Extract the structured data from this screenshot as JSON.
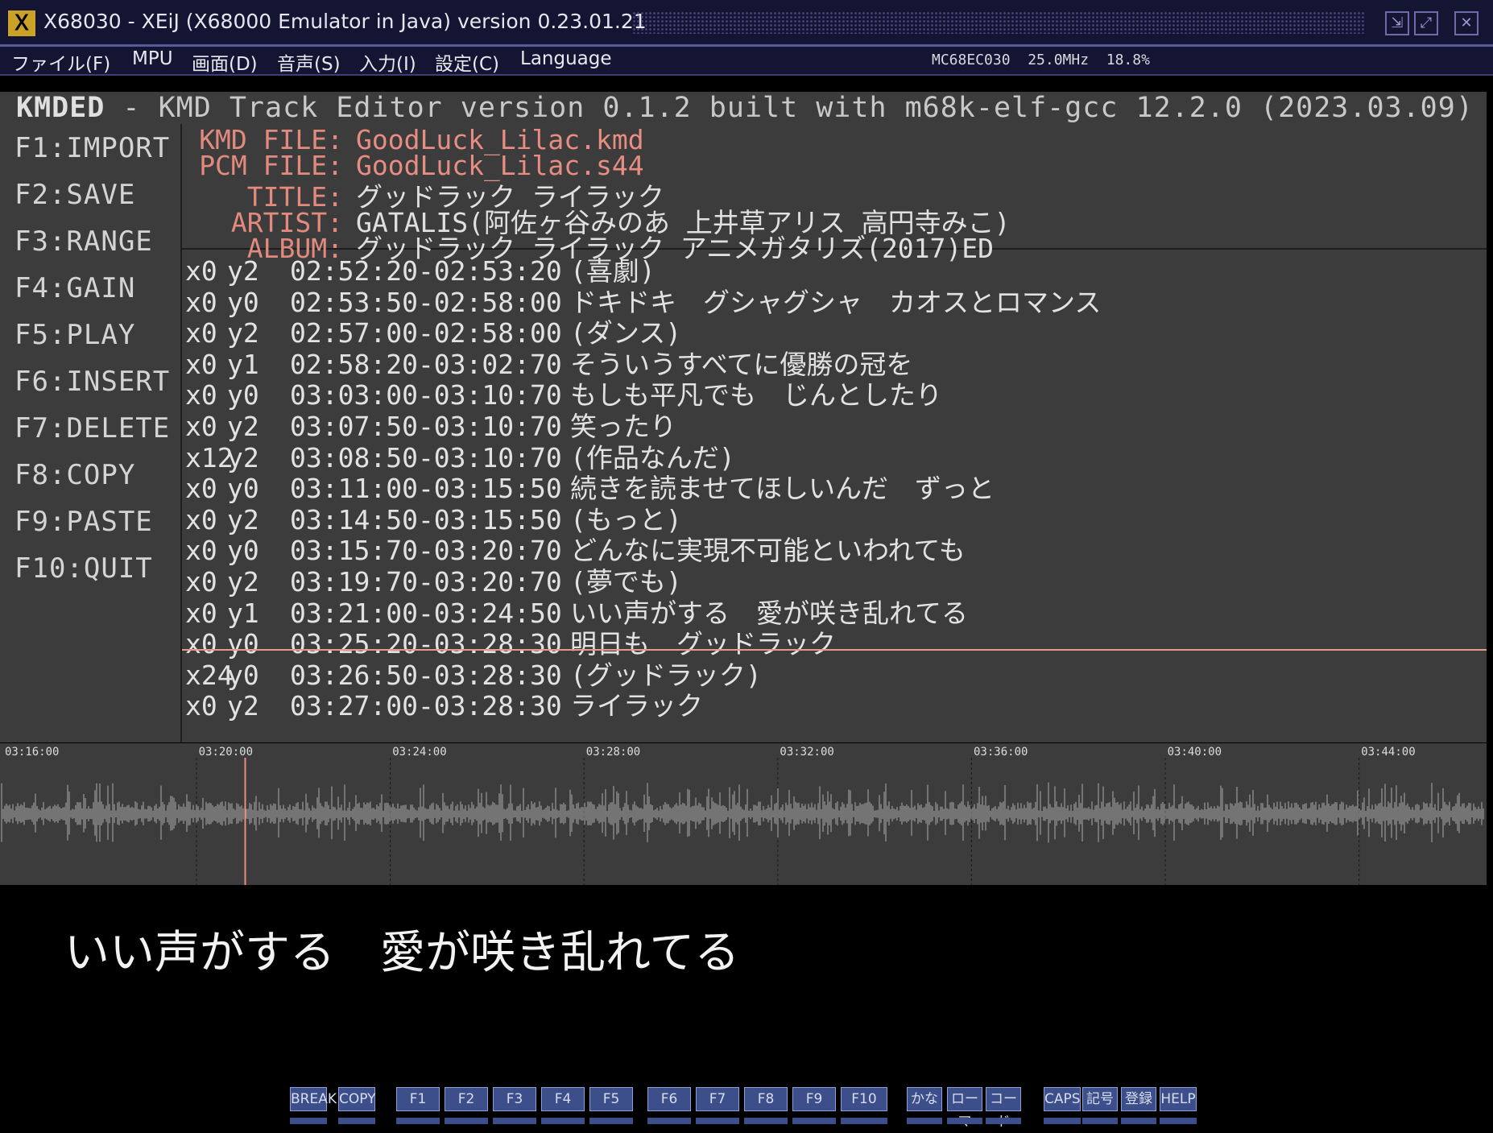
{
  "window": {
    "title": "X68030 - XEiJ (X68000 Emulator in Java) version 0.23.01.21"
  },
  "menu": {
    "items": [
      "ファイル(F)",
      "MPU",
      "画面(D)",
      "音声(S)",
      "入力(I)",
      "設定(C)",
      "Language"
    ],
    "status": "MC68EC030  25.0MHz  18.8%"
  },
  "app": {
    "title_bold": "KMDED",
    "title_rest": " - KMD Track Editor version 0.1.2 built with m68k-elf-gcc 12.2.0 (2023.03.09)"
  },
  "function_keys": [
    "F1:IMPORT",
    "F2:SAVE",
    "F3:RANGE",
    "F4:GAIN",
    "F5:PLAY",
    "F6:INSERT",
    "F7:DELETE",
    "F8:COPY",
    "F9:PASTE",
    "F10:QUIT"
  ],
  "meta": {
    "kmd_label": "KMD FILE:",
    "kmd_value": "GoodLuck_Lilac.kmd",
    "pcm_label": "PCM FILE:",
    "pcm_value": "GoodLuck_Lilac.s44",
    "title_label": "TITLE:",
    "title_value": "グッドラック ライラック",
    "artist_label": "ARTIST:",
    "artist_value": "GATALIS(阿佐ヶ谷みのあ 上井草アリス 高円寺みこ)",
    "album_label": "ALBUM:",
    "album_value": "グッドラック ライラック アニメガタリズ(2017)ED"
  },
  "tracks": [
    {
      "x": "x0",
      "y": "y2",
      "range": "02:52:20-02:53:20",
      "text": "(喜劇)"
    },
    {
      "x": "x0",
      "y": "y0",
      "range": "02:53:50-02:58:00",
      "text": "ドキドキ　グシャグシャ　カオスとロマンス"
    },
    {
      "x": "x0",
      "y": "y2",
      "range": "02:57:00-02:58:00",
      "text": "(ダンス)"
    },
    {
      "x": "x0",
      "y": "y1",
      "range": "02:58:20-03:02:70",
      "text": "そういうすべてに優勝の冠を"
    },
    {
      "x": "x0",
      "y": "y0",
      "range": "03:03:00-03:10:70",
      "text": "もしも平凡でも　じんとしたり"
    },
    {
      "x": "x0",
      "y": "y2",
      "range": "03:07:50-03:10:70",
      "text": "笑ったり"
    },
    {
      "x": "x12",
      "y": "y2",
      "range": "03:08:50-03:10:70",
      "text": "(作品なんだ)"
    },
    {
      "x": "x0",
      "y": "y0",
      "range": "03:11:00-03:15:50",
      "text": "続きを読ませてほしいんだ　ずっと"
    },
    {
      "x": "x0",
      "y": "y2",
      "range": "03:14:50-03:15:50",
      "text": "(もっと)"
    },
    {
      "x": "x0",
      "y": "y0",
      "range": "03:15:70-03:20:70",
      "text": "どんなに実現不可能といわれても"
    },
    {
      "x": "x0",
      "y": "y2",
      "range": "03:19:70-03:20:70",
      "text": "(夢でも)"
    },
    {
      "x": "x0",
      "y": "y1",
      "range": "03:21:00-03:24:50",
      "text": "いい声がする　愛が咲き乱れてる"
    },
    {
      "x": "x0",
      "y": "y0",
      "range": "03:25:20-03:28:30",
      "text": "明日も　グッドラック"
    },
    {
      "x": "x24",
      "y": "y0",
      "range": "03:26:50-03:28:30",
      "text": "(グッドラック)"
    },
    {
      "x": "x0",
      "y": "y2",
      "range": "03:27:00-03:28:30",
      "text": "ライラック"
    }
  ],
  "waveform": {
    "time_labels": [
      "03:16:00",
      "03:20:00",
      "03:24:00",
      "03:28:00",
      "03:32:00",
      "03:36:00",
      "03:40:00",
      "03:44:00"
    ],
    "playhead_time": "03:21:00"
  },
  "lyric": "いい声がする　愛が咲き乱れてる",
  "keyboard": {
    "keys": [
      "BREAK",
      "COPY",
      "F1",
      "F2",
      "F3",
      "F4",
      "F5",
      "F6",
      "F7",
      "F8",
      "F9",
      "F10",
      "かな",
      "ローマ",
      "コード",
      "CAPS",
      "記号",
      "登録",
      "HELP"
    ]
  },
  "colors": {
    "accent_pink": "#e88d82",
    "panel_gray": "#3c3c3c",
    "titlebar": "#141433"
  }
}
